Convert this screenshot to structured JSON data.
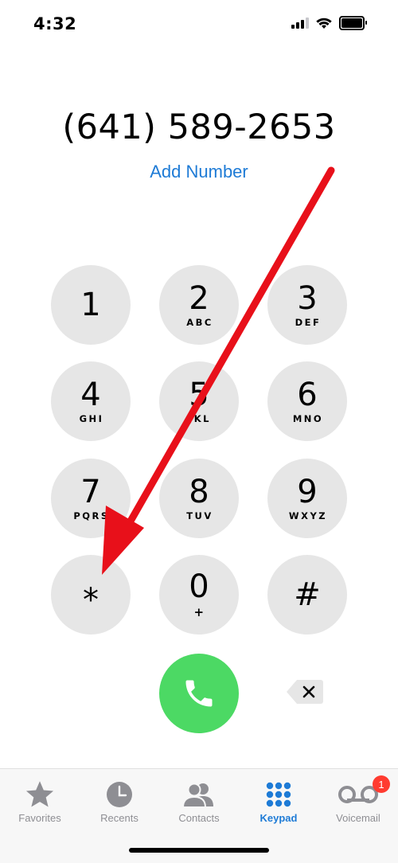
{
  "status": {
    "time": "4:32"
  },
  "dialer": {
    "number": "(641) 589-2653",
    "add_number_label": "Add Number"
  },
  "keypad": {
    "keys": [
      {
        "digit": "1",
        "letters": ""
      },
      {
        "digit": "2",
        "letters": "ABC"
      },
      {
        "digit": "3",
        "letters": "DEF"
      },
      {
        "digit": "4",
        "letters": "GHI"
      },
      {
        "digit": "5",
        "letters": "JKL"
      },
      {
        "digit": "6",
        "letters": "MNO"
      },
      {
        "digit": "7",
        "letters": "PQRS"
      },
      {
        "digit": "8",
        "letters": "TUV"
      },
      {
        "digit": "9",
        "letters": "WXYZ"
      },
      {
        "digit": "*",
        "letters": ""
      },
      {
        "digit": "0",
        "letters": "+"
      },
      {
        "digit": "#",
        "letters": ""
      }
    ],
    "call_icon": "phone-icon",
    "delete_icon": "backspace-icon"
  },
  "tabs": [
    {
      "label": "Favorites",
      "icon": "star-icon",
      "active": false
    },
    {
      "label": "Recents",
      "icon": "clock-icon",
      "active": false
    },
    {
      "label": "Contacts",
      "icon": "contacts-icon",
      "active": false
    },
    {
      "label": "Keypad",
      "icon": "keypad-icon",
      "active": true
    },
    {
      "label": "Voicemail",
      "icon": "voicemail-icon",
      "active": false,
      "badge": "1"
    }
  ],
  "colors": {
    "accent": "#1e7bd6",
    "key_background": "#e6e6e6",
    "call_green": "#4cd964",
    "annotation_arrow": "#e8101a",
    "badge_red": "#ff3b30",
    "inactive_tab": "#8e8e93"
  }
}
